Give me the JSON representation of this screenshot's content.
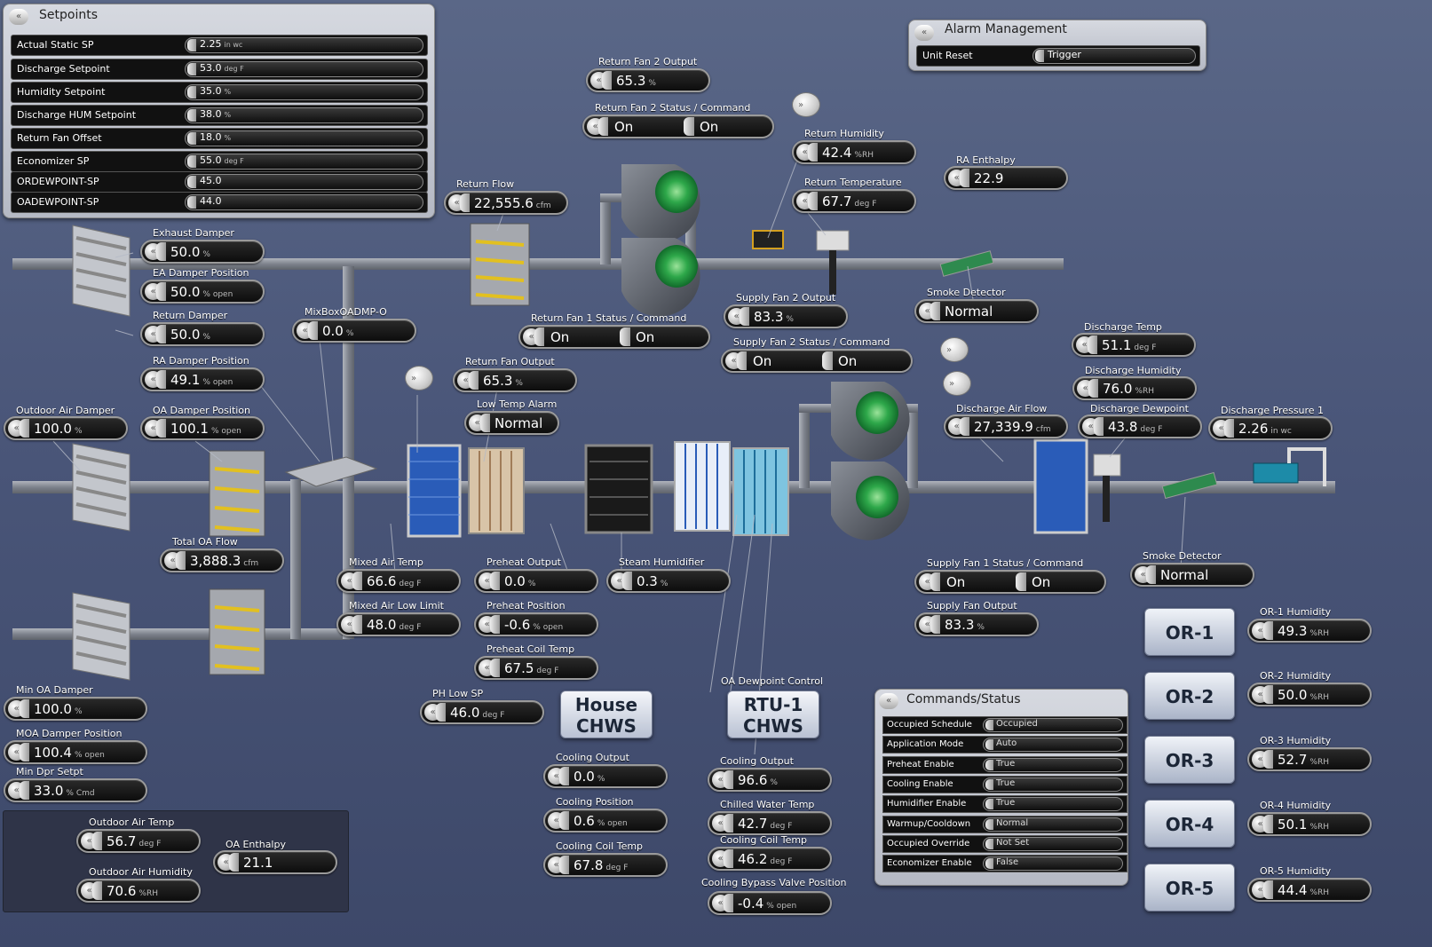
{
  "setpoints": {
    "title": "Setpoints",
    "rows": [
      {
        "label": "Actual Static SP",
        "value": "2.25",
        "unit": "in wc"
      },
      {
        "label": "Discharge Setpoint",
        "value": "53.0",
        "unit": "deg F"
      },
      {
        "label": "Humidity Setpoint",
        "value": "35.0",
        "unit": "%"
      },
      {
        "label": "Discharge HUM Setpoint",
        "value": "38.0",
        "unit": "%"
      },
      {
        "label": "Return Fan Offset",
        "value": "18.0",
        "unit": "%"
      },
      {
        "label": "Economizer SP",
        "value": "55.0",
        "unit": "deg F"
      },
      {
        "label": "ORDEWPOINT-SP",
        "value": "45.0",
        "unit": ""
      },
      {
        "label": "OADEWPOINT-SP",
        "value": "44.0",
        "unit": ""
      }
    ]
  },
  "alarm": {
    "title": "Alarm Management",
    "label": "Unit Reset",
    "button": "Trigger"
  },
  "points": [
    {
      "label": "Return Fan 2 Output",
      "value": "65.3",
      "unit": "%"
    },
    {
      "label": "Return Humidity",
      "value": "42.4",
      "unit": "%RH"
    },
    {
      "label": "RA Enthalpy",
      "value": "22.9",
      "unit": ""
    },
    {
      "label": "Return Temperature",
      "value": "67.7",
      "unit": "deg F"
    },
    {
      "label": "Return Flow",
      "value": "22,555.6",
      "unit": "cfm"
    },
    {
      "label": "Exhaust Damper",
      "value": "50.0",
      "unit": "%"
    },
    {
      "label": "EA Damper Position",
      "value": "50.0",
      "unit": "% open"
    },
    {
      "label": "Return Damper",
      "value": "50.0",
      "unit": "%"
    },
    {
      "label": "MixBoxOADMP-O",
      "value": "0.0",
      "unit": "%"
    },
    {
      "label": "RA Damper Position",
      "value": "49.1",
      "unit": "% open"
    },
    {
      "label": "Supply Fan 2 Output",
      "value": "83.3",
      "unit": "%"
    },
    {
      "label": "Smoke Detector",
      "value": "Normal",
      "unit": ""
    },
    {
      "label": "Return Fan Output",
      "value": "65.3",
      "unit": "%"
    },
    {
      "label": "Low Temp Alarm",
      "value": "Normal",
      "unit": ""
    },
    {
      "label": "Discharge Temp",
      "value": "51.1",
      "unit": "deg F"
    },
    {
      "label": "Discharge Humidity",
      "value": "76.0",
      "unit": "%RH"
    },
    {
      "label": "Outdoor Air Damper",
      "value": "100.0",
      "unit": "%"
    },
    {
      "label": "OA Damper Position",
      "value": "100.1",
      "unit": "% open"
    },
    {
      "label": "Discharge Air Flow",
      "value": "27,339.9",
      "unit": "cfm"
    },
    {
      "label": "Discharge Dewpoint",
      "value": "43.8",
      "unit": "deg F"
    },
    {
      "label": "Discharge Pressure 1",
      "value": "2.26",
      "unit": "in wc"
    },
    {
      "label": "Total OA Flow",
      "value": "3,888.3",
      "unit": "cfm"
    },
    {
      "label": "Mixed Air Temp",
      "value": "66.6",
      "unit": "deg F"
    },
    {
      "label": "Preheat Output",
      "value": "0.0",
      "unit": "%"
    },
    {
      "label": "Steam Humidifier",
      "value": "0.3",
      "unit": "%"
    },
    {
      "label": "Smoke Detector",
      "value": "Normal",
      "unit": ""
    },
    {
      "label": "Mixed Air Low Limit",
      "value": "48.0",
      "unit": "deg F"
    },
    {
      "label": "Preheat Position",
      "value": "-0.6",
      "unit": "% open"
    },
    {
      "label": "Supply Fan Output",
      "value": "83.3",
      "unit": "%"
    },
    {
      "label": "Preheat Coil Temp",
      "value": "67.5",
      "unit": "deg F"
    },
    {
      "label": "Min OA Damper",
      "value": "100.0",
      "unit": "%"
    },
    {
      "label": "PH Low SP",
      "value": "46.0",
      "unit": "deg F"
    },
    {
      "label": "MOA Damper Position",
      "value": "100.4",
      "unit": "% open"
    },
    {
      "label": "Min Dpr Setpt",
      "value": "33.0",
      "unit": "% Cmd"
    },
    {
      "label": "Cooling Output",
      "value": "0.0",
      "unit": "%"
    },
    {
      "label": "Cooling Output",
      "value": "96.6",
      "unit": "%"
    },
    {
      "label": "Cooling Position",
      "value": "0.6",
      "unit": "% open"
    },
    {
      "label": "Chilled Water Temp",
      "value": "42.7",
      "unit": "deg F"
    },
    {
      "label": "Cooling Coil Temp",
      "value": "46.2",
      "unit": "deg F"
    },
    {
      "label": "Cooling Coil Temp",
      "value": "67.8",
      "unit": "deg F"
    },
    {
      "label": "Cooling Bypass Valve Position",
      "value": "-0.4",
      "unit": "% open"
    },
    {
      "label": "Outdoor Air Temp",
      "value": "56.7",
      "unit": "deg F"
    },
    {
      "label": "OA Enthalpy",
      "value": "21.1",
      "unit": ""
    },
    {
      "label": "Outdoor Air Humidity",
      "value": "70.6",
      "unit": "%RH"
    },
    {
      "label": "OR-1 Humidity",
      "value": "49.3",
      "unit": "%RH"
    },
    {
      "label": "OR-2 Humidity",
      "value": "50.0",
      "unit": "%RH"
    },
    {
      "label": "OR-3 Humidity",
      "value": "52.7",
      "unit": "%RH"
    },
    {
      "label": "OR-4 Humidity",
      "value": "50.1",
      "unit": "%RH"
    },
    {
      "label": "OR-5 Humidity",
      "value": "44.4",
      "unit": "%RH"
    }
  ],
  "duals": [
    {
      "label": "Return Fan 2 Status / Command",
      "a": "On",
      "b": "On"
    },
    {
      "label": "Return Fan 1 Status / Command",
      "a": "On",
      "b": "On"
    },
    {
      "label": "Supply Fan 2 Status / Command",
      "a": "On",
      "b": "On"
    },
    {
      "label": "Supply Fan 1 Status / Command",
      "a": "On",
      "b": "On"
    }
  ],
  "buttons": {
    "house_chws_1": "House",
    "house_chws_2": "CHWS",
    "rtu_1": "RTU-1",
    "rtu_2": "CHWS",
    "oa_dewpoint_label": "OA Dewpoint Control",
    "or": [
      "OR-1",
      "OR-2",
      "OR-3",
      "OR-4",
      "OR-5"
    ]
  },
  "commands": {
    "title": "Commands/Status",
    "rows": [
      {
        "label": "Occupied Schedule",
        "value": "Occupied"
      },
      {
        "label": "Application Mode",
        "value": "Auto"
      },
      {
        "label": "Preheat Enable",
        "value": "True"
      },
      {
        "label": "Cooling Enable",
        "value": "True"
      },
      {
        "label": "Humidifier Enable",
        "value": "True"
      },
      {
        "label": "Warmup/Cooldown",
        "value": "Normal"
      },
      {
        "label": "Occupied Override",
        "value": "Not Set"
      },
      {
        "label": "Economizer Enable",
        "value": "False"
      }
    ]
  },
  "colors": {
    "background": "#4a5679",
    "duct": "#8a8f99",
    "fan_green": "#2ea84a",
    "coil_blue": "#2a5cb8"
  }
}
